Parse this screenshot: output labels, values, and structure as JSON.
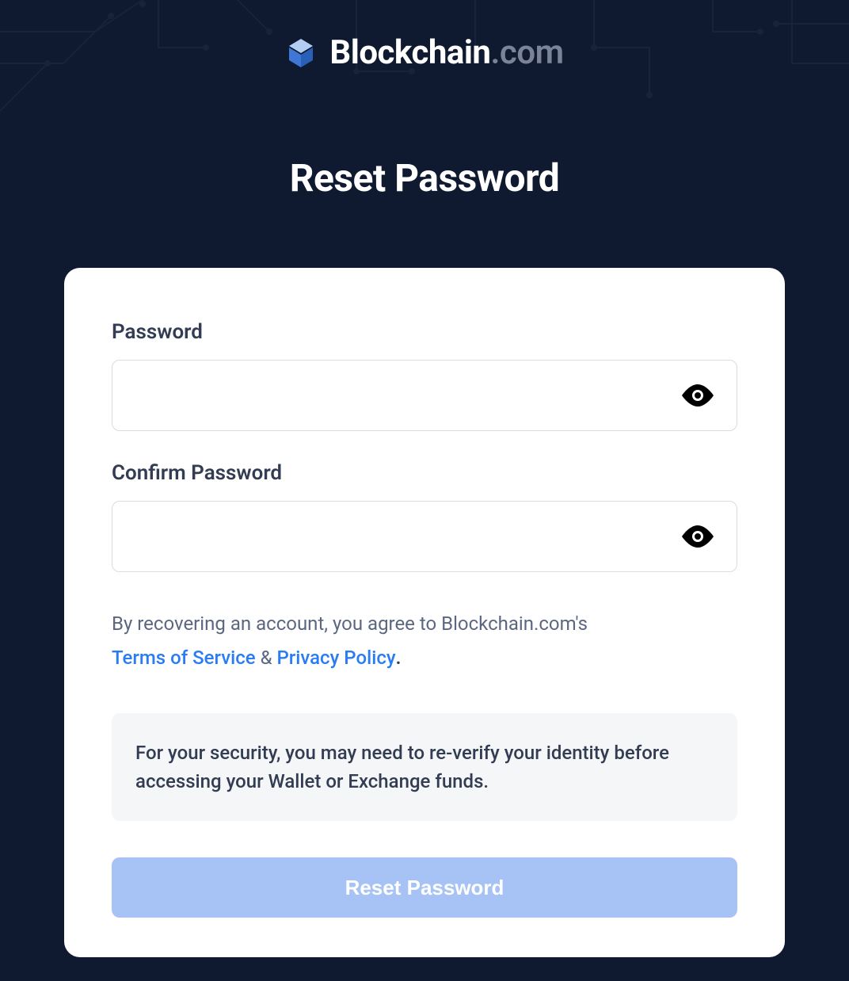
{
  "brand": {
    "name_main": "Blockchain",
    "name_suffix": ".com"
  },
  "page": {
    "title": "Reset Password"
  },
  "form": {
    "password_label": "Password",
    "confirm_password_label": "Confirm Password",
    "agreement_prefix": "By recovering an account, you agree to Blockchain.com's",
    "terms_link_text": "Terms of Service",
    "amp_text": " & ",
    "privacy_link_text": "Privacy Policy",
    "period_text": ".",
    "security_notice": "For your security, you may need to re-verify your identity before accessing your Wallet or Exchange funds.",
    "submit_label": "Reset Password"
  }
}
